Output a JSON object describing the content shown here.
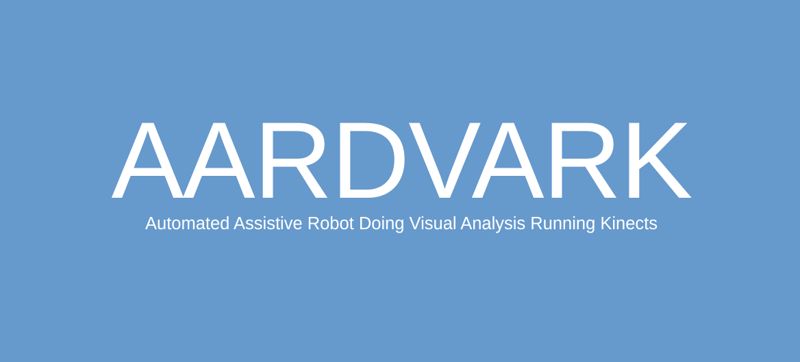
{
  "banner": {
    "title": "AARDVARK",
    "subtitle": "Automated Assistive Robot Doing Visual Analysis Running Kinects",
    "background_color": "#6699cc",
    "text_color": "#ffffff"
  }
}
